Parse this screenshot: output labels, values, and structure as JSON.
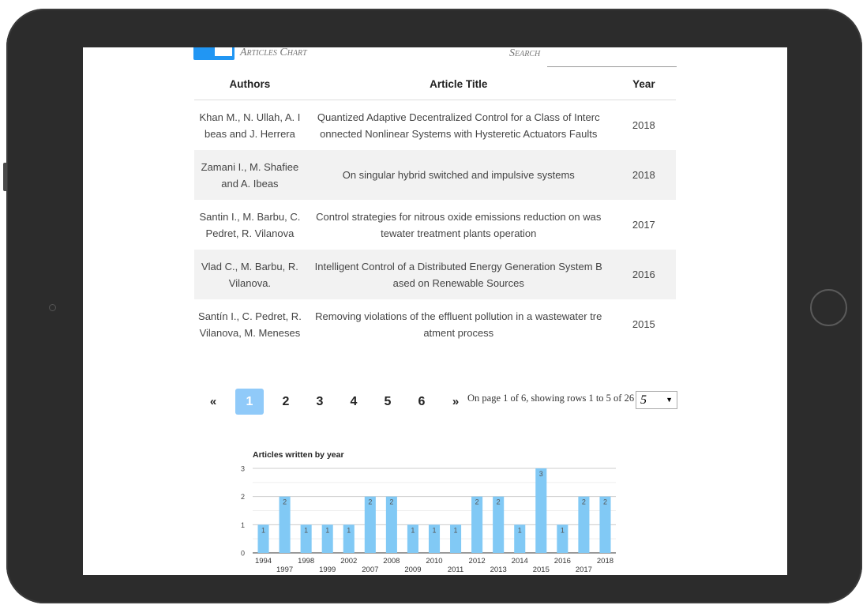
{
  "header": {
    "chart_link": "Articles Chart",
    "search_label": "Search",
    "search_value": ""
  },
  "table": {
    "headers": [
      "Authors",
      "Article Title",
      "Year"
    ],
    "rows": [
      {
        "authors": "Khan M., N. Ullah, A. I beas and J. Herrera",
        "title": "Quantized Adaptive Decentralized Control for a Class of Interc onnected Nonlinear Systems with Hysteretic Actuators Faults",
        "year": "2018"
      },
      {
        "authors": "Zamani I., M. Shafiee and A. Ibeas",
        "title": "On singular hybrid switched and impulsive systems",
        "year": "2018"
      },
      {
        "authors": "Santin I., M. Barbu, C. Pedret, R. Vilanova",
        "title": "Control strategies for nitrous oxide emissions reduction on was tewater treatment plants operation",
        "year": "2017"
      },
      {
        "authors": "Vlad C., M. Barbu, R. Vilanova.",
        "title": "Intelligent Control of a Distributed Energy Generation System B ased on Renewable Sources",
        "year": "2016"
      },
      {
        "authors": "Santín I., C. Pedret, R. Vilanova, M. Meneses",
        "title": "Removing violations of the effluent pollution in a wastewater tre atment process",
        "year": "2015"
      }
    ]
  },
  "pagination": {
    "prev": "«",
    "pages": [
      "1",
      "2",
      "3",
      "4",
      "5",
      "6"
    ],
    "next": "»",
    "active": "1",
    "info": "On page 1 of 6, showing rows 1 to 5 of 26",
    "rows_per_page": "5"
  },
  "colors": {
    "accent": "#2196f3",
    "active_page": "#90caf9",
    "bar": "#81c9f5"
  },
  "chart_data": {
    "type": "bar",
    "title": "Articles written by year",
    "categories": [
      "1994",
      "1997",
      "1998",
      "1999",
      "2002",
      "2007",
      "2008",
      "2009",
      "2010",
      "2011",
      "2012",
      "2013",
      "2014",
      "2015",
      "2016",
      "2017",
      "2018"
    ],
    "values": [
      1,
      2,
      1,
      1,
      1,
      2,
      2,
      1,
      1,
      1,
      2,
      2,
      1,
      3,
      1,
      2,
      2
    ],
    "yticks": [
      0,
      1,
      2,
      3
    ],
    "ylim": [
      0,
      3
    ],
    "grid": true,
    "data_labels": true
  }
}
